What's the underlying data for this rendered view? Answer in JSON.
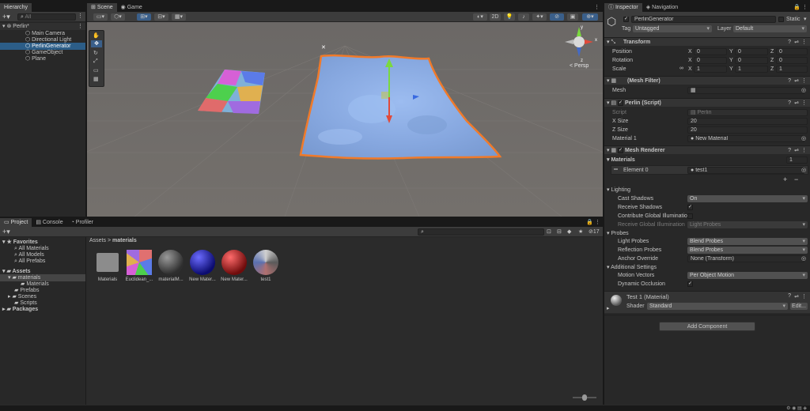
{
  "hierarchy": {
    "tab": "Hierarchy",
    "search_placeholder": "All",
    "scene": "Perlin*",
    "items": [
      "Main Camera",
      "Directional Light",
      "PerlinGenerator",
      "GameObject",
      "Plane"
    ]
  },
  "scene_view": {
    "tabs": [
      "Scene",
      "Game"
    ],
    "toolbar_2d": "2D",
    "persp": "< Persp",
    "gizmo_axes": [
      "y",
      "x",
      "z"
    ]
  },
  "project": {
    "tabs": [
      "Project",
      "Console",
      "Profiler"
    ],
    "hidden_count": "17",
    "favorites_label": "Favorites",
    "favorites": [
      "All Materials",
      "All Models",
      "All Prefabs"
    ],
    "assets_label": "Assets",
    "folders": [
      "materials",
      "Materials",
      "Prefabs",
      "Scenes",
      "Scripts"
    ],
    "packages_label": "Packages",
    "breadcrumb_root": "Assets",
    "breadcrumb_sep": ">",
    "breadcrumb_current": "materials",
    "assets": [
      {
        "name": "Materials",
        "kind": "folder",
        "color": "#8c8c8c"
      },
      {
        "name": "Euclidean_...",
        "kind": "texture",
        "color": "#e07070"
      },
      {
        "name": "materialM...",
        "kind": "sphere",
        "color": "#5a5a5a"
      },
      {
        "name": "New Mater...",
        "kind": "sphere",
        "color": "#1a1ab4"
      },
      {
        "name": "New Mater...",
        "kind": "sphere",
        "color": "#b41a1a"
      },
      {
        "name": "test1",
        "kind": "sphere",
        "color": "#9a9a9a"
      }
    ]
  },
  "inspector": {
    "tabs": [
      "Inspector",
      "Navigation"
    ],
    "object_name": "PerlinGenerator",
    "static_label": "Static",
    "tag_label": "Tag",
    "tag_value": "Untagged",
    "layer_label": "Layer",
    "layer_value": "Default",
    "transform": {
      "title": "Transform",
      "rows": [
        {
          "label": "Position",
          "x": "0",
          "y": "0",
          "z": "0"
        },
        {
          "label": "Rotation",
          "x": "0",
          "y": "0",
          "z": "0"
        },
        {
          "label": "Scale",
          "x": "1",
          "y": "1",
          "z": "1"
        }
      ],
      "axis_x": "X",
      "axis_y": "Y",
      "axis_z": "Z"
    },
    "mesh_filter": {
      "title": "(Mesh Filter)",
      "mesh_label": "Mesh"
    },
    "perlin_script": {
      "title": "Perlin (Script)",
      "script_label": "Script",
      "script_value": "Perlin",
      "xsize_label": "X Size",
      "xsize_value": "20",
      "zsize_label": "Z Size",
      "zsize_value": "20",
      "material_label": "Material 1",
      "material_value": "New Material"
    },
    "mesh_renderer": {
      "title": "Mesh Renderer",
      "materials_label": "Materials",
      "materials_count": "1",
      "element_label": "Element 0",
      "element_value": "test1",
      "lighting_label": "Lighting",
      "cast_shadows_label": "Cast Shadows",
      "cast_shadows_value": "On",
      "receive_shadows_label": "Receive Shadows",
      "contribute_gi_label": "Contribute Global Illumination",
      "receive_gi_label": "Receive Global Illumination",
      "receive_gi_value": "Light Probes",
      "probes_label": "Probes",
      "light_probes_label": "Light Probes",
      "light_probes_value": "Blend Probes",
      "reflection_probes_label": "Reflection Probes",
      "reflection_probes_value": "Blend Probes",
      "anchor_override_label": "Anchor Override",
      "anchor_override_value": "None (Transform)",
      "additional_label": "Additional Settings",
      "motion_vectors_label": "Motion Vectors",
      "motion_vectors_value": "Per Object Motion",
      "dynamic_occlusion_label": "Dynamic Occlusion"
    },
    "material": {
      "title": "Test 1 (Material)",
      "shader_label": "Shader",
      "shader_value": "Standard",
      "edit_label": "Edit..."
    },
    "add_component": "Add Component"
  },
  "colors": {
    "selection": "#2c5d87",
    "terrain": "#8fb0e6",
    "outline": "#f07a2a",
    "scene_bg": "#6f6b68"
  }
}
